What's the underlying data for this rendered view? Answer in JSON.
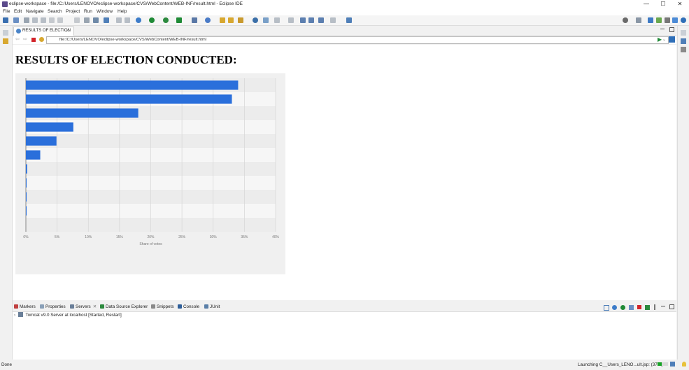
{
  "window": {
    "title": "eclipse-workspace - file:/C:/Users/LENOVO/eclipse-workspace/CVS/WebContent/WEB-INF/result.html - Eclipse IDE",
    "minimize": "—",
    "maximize": "☐",
    "close": "✕"
  },
  "menu": [
    "File",
    "Edit",
    "Navigate",
    "Search",
    "Project",
    "Run",
    "Window",
    "Help"
  ],
  "editor": {
    "tab_label": "RESULTS OF ELECTION",
    "tab_close": "✕",
    "url": "file:/C:/Users/LENOVO/eclipse-workspace/CVS/WebContent/WEB-INF/result.html"
  },
  "page": {
    "heading": "RESULTS OF ELECTION CONDUCTED:"
  },
  "chart_data": {
    "type": "bar",
    "orientation": "horizontal",
    "xlabel": "Share of votes",
    "xlim": [
      0,
      40
    ],
    "ticks": [
      "0%",
      "5%",
      "10%",
      "15%",
      "20%",
      "25%",
      "30%",
      "35%",
      "40%"
    ],
    "values": [
      34,
      33,
      18,
      7.6,
      4.9,
      2.3,
      0.2,
      0.1,
      0.1,
      0.1,
      0
    ],
    "bar_color": "#2a6fdb",
    "grid": true
  },
  "panel": {
    "tabs": [
      "Markers",
      "Properties",
      "Servers",
      "Data Source Explorer",
      "Snippets",
      "Console",
      "JUnit"
    ],
    "server_row": "Tomcat v9.0 Server at localhost  [Started, Restart]"
  },
  "status": {
    "left": "Done",
    "launch": "Launching C__Users_LENO...ult.jsp: (37%)",
    "progress_value": 0.37
  }
}
